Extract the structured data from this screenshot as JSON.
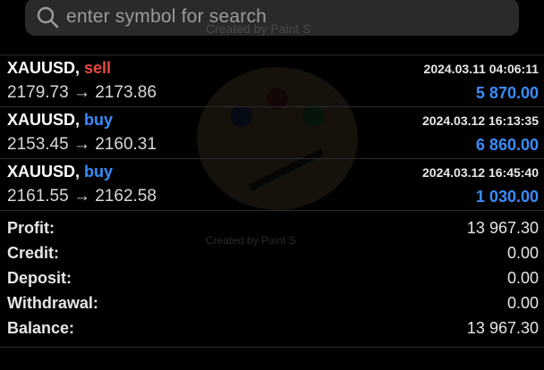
{
  "search": {
    "placeholder": "enter symbol for search"
  },
  "watermark": {
    "text": "Created by Paint S"
  },
  "trades": [
    {
      "symbol": "XAUUSD,",
      "side": "sell",
      "prices": "2179.73 → 2173.86",
      "time": "2024.03.11 04:06:11",
      "amount": "5 870.00"
    },
    {
      "symbol": "XAUUSD,",
      "side": "buy",
      "prices": "2153.45 → 2160.31",
      "time": "2024.03.12 16:13:35",
      "amount": "6 860.00"
    },
    {
      "symbol": "XAUUSD,",
      "side": "buy",
      "prices": "2161.55 → 2162.58",
      "time": "2024.03.12 16:45:40",
      "amount": "1 030.00"
    }
  ],
  "summary": {
    "profit_label": "Profit:",
    "profit": "13 967.30",
    "credit_label": "Credit:",
    "credit": "0.00",
    "deposit_label": "Deposit:",
    "deposit": "0.00",
    "withdrawal_label": "Withdrawal:",
    "withdrawal": "0.00",
    "balance_label": "Balance:",
    "balance": "13 967.30"
  },
  "colors": {
    "sell": "#e84a3f",
    "buy": "#3a8cff",
    "background": "#000000"
  },
  "icons": {
    "search": "search-icon"
  }
}
